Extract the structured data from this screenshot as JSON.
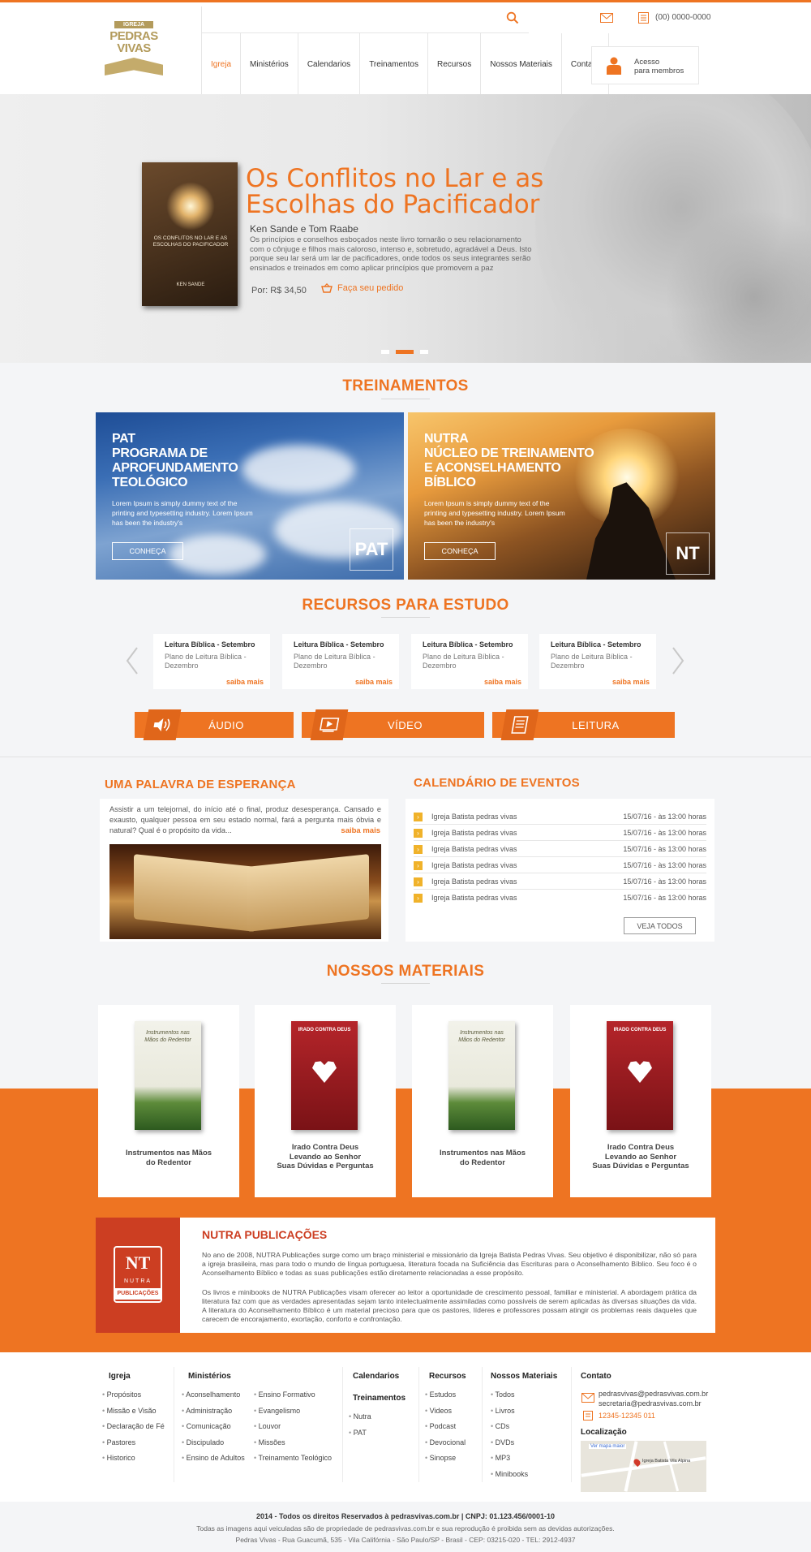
{
  "header": {
    "logo_top": "IGREJA BATISTA",
    "logo_main_1": "PEDRAS",
    "logo_main_2": "VIVAS",
    "phone": "(00) 0000-0000",
    "nav": [
      "Igreja",
      "Ministérios",
      "Calendarios",
      "Treinamentos",
      "Recursos",
      "Nossos Materiais",
      "Contato"
    ],
    "member_line1": "Acesso",
    "member_line2": "para membros"
  },
  "hero": {
    "title": "Os Conflitos no Lar e as Escolhas do Pacificador",
    "authors": "Ken Sande e Tom Raabe",
    "description": "Os princípios e conselhos esboçados neste livro tornarão o seu relacionamento com o cônjuge e filhos mais caloroso, intenso e, sobretudo, agradável a Deus. Isto porque seu lar será um lar de pacificadores, onde todos os seus integrantes serão ensinados e treinados em como aplicar princípios que promovem a paz",
    "price": "Por: R$ 34,50",
    "order_label": "Faça seu pedido",
    "book_title": "OS CONFLITOS NO LAR E AS ESCOLHAS DO PACIFICADOR",
    "book_author": "KEN SANDE"
  },
  "treinamentos": {
    "title": "TREINAMENTOS",
    "cards": [
      {
        "l1": "PAT",
        "l2": "PROGRAMA DE",
        "l3": "APROFUNDAMENTO",
        "l4": "TEOLÓGICO",
        "text": "Lorem Ipsum is simply dummy text of the printing and typesetting industry. Lorem Ipsum has been the industry's",
        "button": "CONHEÇA",
        "badge": "PAT"
      },
      {
        "l1": "NUTRA",
        "l2": "NÚCLEO DE TREINAMENTO",
        "l3": "E ACONSELHAMENTO",
        "l4": "BÍBLICO",
        "text": "Lorem Ipsum is simply dummy text of the printing and typesetting industry. Lorem Ipsum has been the industry's",
        "button": "CONHEÇA",
        "badge": "NT"
      }
    ]
  },
  "recursos": {
    "title": "RECURSOS PARA ESTUDO",
    "items": [
      {
        "title": "Leitura Bíblica - Setembro",
        "desc": "Plano de Leitura Bíblica - Dezembro",
        "more": "saiba mais"
      },
      {
        "title": "Leitura Bíblica - Setembro",
        "desc": "Plano de Leitura Bíblica - Dezembro",
        "more": "saiba mais"
      },
      {
        "title": "Leitura Bíblica - Setembro",
        "desc": "Plano de Leitura Bíblica - Dezembro",
        "more": "saiba mais"
      },
      {
        "title": "Leitura Bíblica - Setembro",
        "desc": "Plano de Leitura Bíblica - Dezembro",
        "more": "saiba mais"
      }
    ],
    "media": [
      "ÁUDIO",
      "VÍDEO",
      "LEITURA"
    ]
  },
  "esperanca": {
    "title": "UMA PALAVRA DE ESPERANÇA",
    "text": "Assistir a um telejornal, do início até o final, produz desesperança. Cansado e exausto, qualquer pessoa em seu estado normal, fará a pergunta mais óbvia e natural? Qual é o propósito da vida...",
    "more": "saiba mais"
  },
  "calendario": {
    "title": "CALENDÁRIO DE EVENTOS",
    "events": [
      {
        "name": "Igreja Batista pedras vivas",
        "date": "15/07/16 - às 13:00 horas"
      },
      {
        "name": "Igreja Batista pedras vivas",
        "date": "15/07/16 - às 13:00 horas"
      },
      {
        "name": "Igreja Batista pedras vivas",
        "date": "15/07/16 - às 13:00 horas"
      },
      {
        "name": "Igreja Batista pedras vivas",
        "date": "15/07/16 - às 13:00 horas"
      },
      {
        "name": "Igreja Batista pedras vivas",
        "date": "15/07/16 - às 13:00 horas"
      },
      {
        "name": "Igreja Batista pedras vivas",
        "date": "15/07/16 - às 13:00 horas"
      }
    ],
    "view_all": "VEJA TODOS"
  },
  "materiais": {
    "title": "NOSSOS MATERIAIS",
    "items": [
      {
        "l1": "Instrumentos nas Mãos",
        "l2": "do Redentor",
        "l3": "",
        "cover_title": "Instrumentos nas Mãos do Redentor"
      },
      {
        "l1": "Irado Contra Deus",
        "l2": "Levando ao Senhor",
        "l3": "Suas Dúvidas e Perguntas",
        "cover_title": "IRADO CONTRA DEUS"
      },
      {
        "l1": "Instrumentos nas Mãos",
        "l2": "do Redentor",
        "l3": "",
        "cover_title": "Instrumentos nas Mãos do Redentor"
      },
      {
        "l1": "Irado Contra Deus",
        "l2": "Levando ao Senhor",
        "l3": "Suas Dúvidas e Perguntas",
        "cover_title": "IRADO CONTRA DEUS"
      }
    ]
  },
  "nutra": {
    "title": "NUTRA PUBLICAÇÕES",
    "logo_label": "PUBLICAÇÕES",
    "logo_text": "NUTRA",
    "p1": "No ano de 2008, NUTRA Publicações surge como um braço ministerial e missionário da Igreja Batista Pedras Vivas. Seu objetivo é disponibilizar, não só para a igreja brasileira, mas para todo o mundo de língua portuguesa, literatura focada na Suficiência das Escrituras para o Aconselhamento Bíblico. Seu foco é o Aconselhamento Bíblico e todas as suas publicações estão diretamente relacionadas a esse propósito.",
    "p2": "Os livros e minibooks de NUTRA Publicações visam oferecer ao leitor a oportunidade de crescimento pessoal, familiar e ministerial. A abordagem prática da literatura faz com que as verdades apresentadas sejam tanto intelectualmente assimiladas como possíveis de serem aplicadas às diversas situações da vida. A literatura do Aconselhamento Bíblico é um material precioso para que os pastores, líderes e professores possam atingir os problemas reais daqueles que carecem de encorajamento, exortação, conforto e confrontação."
  },
  "footer": {
    "igreja": {
      "title": "Igreja",
      "items": [
        "Propósitos",
        "Missão e Visão",
        "Declaração de Fé",
        "Pastores",
        "Historico"
      ]
    },
    "ministerios": {
      "title": "Ministérios",
      "col1": [
        "Aconselhamento",
        "Administração",
        "Comunicação",
        "Discipulado",
        "Ensino de Adultos"
      ],
      "col2": [
        "Ensino Formativo",
        "Evangelismo",
        "Louvor",
        "Missões",
        "Treinamento Teológico"
      ]
    },
    "calendarios": {
      "title": "Calendarios"
    },
    "treinamentos": {
      "title": "Treinamentos",
      "items": [
        "Nutra",
        "PAT"
      ]
    },
    "recursos": {
      "title": "Recursos",
      "items": [
        "Estudos",
        "Videos",
        "Podcast",
        "Devocional",
        "Sinopse"
      ]
    },
    "materiais": {
      "title": "Nossos Materiais",
      "items": [
        "Todos",
        "Livros",
        "CDs",
        "DVDs",
        "MP3",
        "Minibooks"
      ]
    },
    "contato": {
      "title": "Contato",
      "email1": "pedrasvivas@pedrasvivas.com.br",
      "email2": "secretaria@pedrasvivas.com.br",
      "phone": "12345-12345 011"
    },
    "localizacao": {
      "title": "Localização",
      "map_link": "Ver mapa maior",
      "map_place": "Igreja Batista Vila Alpina"
    },
    "copyright": "2014 - Todos os direitos Reservados à pedrasvivas.com.br | CNPJ: 01.123.456/0001-10",
    "notice": "Todas as imagens aqui veiculadas são de propriedade de pedrasvivas.com.br e sua reprodução é proibida sem as devidas autorizações.",
    "address": "Pedras Vivas - Rua Guacumã, 535 - Vila Califórnia - São Paulo/SP - Brasil - CEP: 03215-020 - TEL: 2912-4937"
  },
  "colors": {
    "accent": "#ee7422",
    "nutra_red": "#cc3e22",
    "badge_yellow": "#f0b22a"
  }
}
